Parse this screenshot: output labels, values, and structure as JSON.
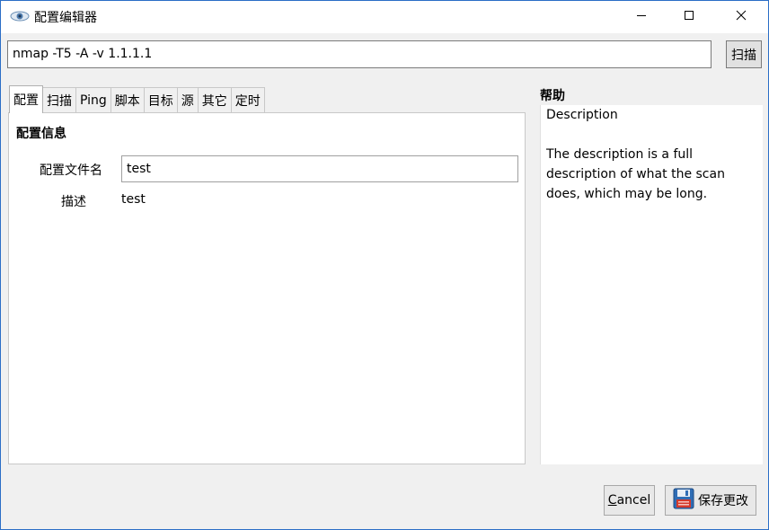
{
  "window": {
    "title": "配置编辑器",
    "icons": {
      "app": "eye-icon",
      "minimize": "minimize-icon",
      "maximize": "maximize-icon",
      "close": "close-icon"
    }
  },
  "command": {
    "value": "nmap -T5 -A -v  1.1.1.1",
    "scan_label": "扫描"
  },
  "tabs": [
    {
      "label": "配置",
      "active": true
    },
    {
      "label": "扫描"
    },
    {
      "label": "Ping"
    },
    {
      "label": "脚本"
    },
    {
      "label": "目标"
    },
    {
      "label": "源"
    },
    {
      "label": "其它"
    },
    {
      "label": "定时"
    }
  ],
  "profile": {
    "section_title": "配置信息",
    "name_label": "配置文件名",
    "name_value": "test",
    "desc_label": "描述",
    "desc_value": "test"
  },
  "help": {
    "title": "帮助",
    "heading": "Description",
    "body": "The description is a full description of what the scan does, which may be long."
  },
  "buttons": {
    "cancel": "Cancel",
    "save": "保存更改",
    "save_icon": "floppy-disk-icon"
  }
}
